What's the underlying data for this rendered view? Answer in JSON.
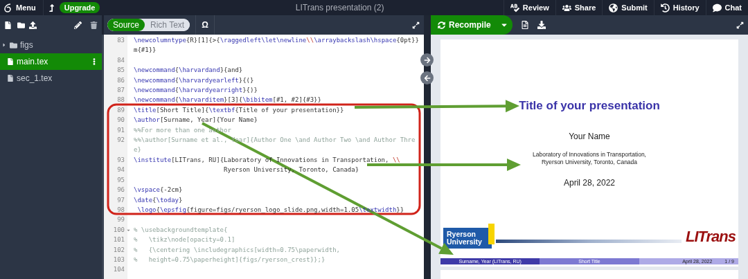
{
  "top_bar": {
    "menu": "Menu",
    "upgrade": "Upgrade",
    "title": "LITrans presentation (2)",
    "actions": [
      {
        "label": "Review",
        "kind": "review"
      },
      {
        "label": "Share",
        "kind": "share"
      },
      {
        "label": "Submit",
        "kind": "submit"
      },
      {
        "label": "History",
        "kind": "history"
      },
      {
        "label": "Chat",
        "kind": "chat"
      }
    ]
  },
  "file_tree": {
    "items": [
      {
        "name": "figs",
        "kind": "folder",
        "selected": false
      },
      {
        "name": "main.tex",
        "kind": "file",
        "selected": true
      },
      {
        "name": "sec_1.tex",
        "kind": "file",
        "selected": false
      }
    ]
  },
  "editor": {
    "modes": [
      {
        "label": "Source",
        "selected": true
      },
      {
        "label": "Rich Text",
        "selected": false
      }
    ],
    "symbol_button": "Ω",
    "lines": [
      {
        "number": "83",
        "text": "\\newcolumntype{R}[1]{>{\\raggedleft\\let\\newline\\\\\\arraybackslash\\hspace{0pt}}m{#1}}",
        "kind": "code",
        "foldable": false
      },
      {
        "number": "84",
        "kind": "code",
        "foldable": false
      },
      {
        "number": "85",
        "text": "\\newcommand{\\harvardand}{and}",
        "kind": "code",
        "foldable": false
      },
      {
        "number": "86",
        "text": "\\newcommand{\\harvardyearleft}{(}",
        "kind": "code",
        "foldable": false
      },
      {
        "number": "87",
        "text": "\\newcommand{\\harvardyearright}{)}",
        "kind": "code",
        "foldable": false
      },
      {
        "number": "88",
        "text": "\\newcommand{\\harvarditem}[3]{\\bibitem[#1, #2]{#3}}",
        "kind": "code",
        "foldable": false
      },
      {
        "number": "89",
        "text": "\\title[Short Title]{\\textbf{Title of your presentation}}",
        "kind": "code",
        "foldable": false
      },
      {
        "number": "90",
        "text": "\\author[Surname, Year]{Your Name}",
        "kind": "code",
        "foldable": false
      },
      {
        "number": "91",
        "text": "%%For more than one author",
        "kind": "comment",
        "foldable": false
      },
      {
        "number": "92",
        "text": "%%\\author[Surname et al., Year]{Author One \\and Author Two \\and Author Three}",
        "kind": "comment",
        "foldable": false
      },
      {
        "number": "93",
        "text": "\\institute[LITrans, RU]{Laboratory of Innovations in Transportation, \\\\",
        "kind": "code",
        "foldable": false
      },
      {
        "number": "94",
        "text": "                        Ryerson University, Toronto, Canada}",
        "kind": "code",
        "foldable": false
      },
      {
        "number": "95",
        "kind": "code",
        "foldable": false
      },
      {
        "number": "96",
        "text": "\\vspace{-2cm}",
        "kind": "code",
        "foldable": false
      },
      {
        "number": "97",
        "text": "\\date{\\today}",
        "kind": "code",
        "foldable": false
      },
      {
        "number": "98",
        "text": " \\logo{\\epsfig{figure=figs/ryerson_logo_slide.png,width=1.05\\textwidth}}",
        "kind": "code",
        "foldable": false
      },
      {
        "number": "99",
        "kind": "code",
        "foldable": false
      },
      {
        "number": "100",
        "text": "% \\usebackgroundtemplate{",
        "kind": "comment",
        "foldable": true
      },
      {
        "number": "101",
        "text": "%   \\tikz\\node[opacity=0.1]",
        "kind": "comment",
        "foldable": false
      },
      {
        "number": "102",
        "text": "%   {\\centering \\includegraphics[width=0.75\\paperwidth,",
        "kind": "comment",
        "foldable": false
      },
      {
        "number": "103",
        "text": "%   height=0.75\\paperheight]{figs/ryerson_crest}};}",
        "kind": "comment",
        "foldable": false
      },
      {
        "number": "104",
        "kind": "code",
        "foldable": false
      }
    ]
  },
  "preview": {
    "recompile": "Recompile",
    "slide": {
      "title": "Title of your presentation",
      "author": "Your Name",
      "institute": [
        "Laboratory of Innovations in Transportation,",
        "Ryerson University, Toronto, Canada"
      ],
      "date": "April 28, 2022",
      "left_logo": [
        "Ryerson",
        "University"
      ],
      "right_logo": "LITrans",
      "footer": [
        "Surname, Year  (LITrans, RU)",
        "Short Title",
        "April 28, 2022",
        "1 / 9"
      ]
    }
  }
}
